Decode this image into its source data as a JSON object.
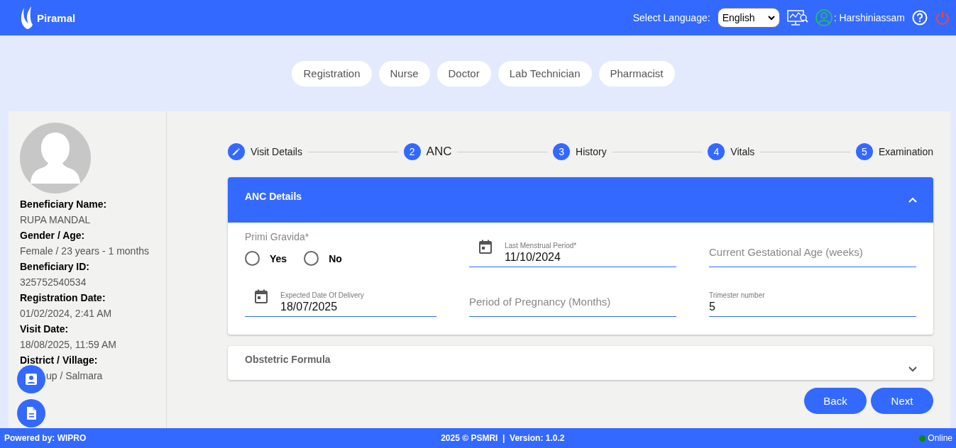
{
  "header": {
    "brand": "Piramal",
    "language_label": "Select Language:",
    "language": "English",
    "user": ": Harshiniassam"
  },
  "roles": [
    {
      "label": "Registration"
    },
    {
      "label": "Nurse"
    },
    {
      "label": "Doctor"
    },
    {
      "label": "Lab Technician"
    },
    {
      "label": "Pharmacist"
    }
  ],
  "beneficiary": [
    {
      "label": "Beneficiary Name:",
      "value": "RUPA MANDAL"
    },
    {
      "label": "Gender / Age:",
      "value": "Female / 23 years - 1 months"
    },
    {
      "label": "Beneficiary ID:",
      "value": "325752540534"
    },
    {
      "label": "Registration Date:",
      "value": "01/02/2024, 2:41 AM"
    },
    {
      "label": "Visit Date:",
      "value": "18/08/2025, 11:59 AM"
    },
    {
      "label": "District / Village:",
      "value": "up / Salmara"
    }
  ],
  "steps": [
    {
      "label": "Visit Details",
      "completed": true,
      "active": false
    },
    {
      "number": "2",
      "label": "ANC",
      "completed": false,
      "active": true
    },
    {
      "number": "3",
      "label": "History",
      "completed": false,
      "active": false
    },
    {
      "number": "4",
      "label": "Vitals",
      "completed": false,
      "active": false
    },
    {
      "number": "5",
      "label": "Examination",
      "completed": false,
      "active": false
    }
  ],
  "anc_panel": {
    "title": "ANC Details",
    "expanded": true,
    "primi_gravida": {
      "label": "Primi Gravida*",
      "options": [
        {
          "label": "Yes",
          "selected": false
        },
        {
          "label": "No",
          "selected": false
        }
      ]
    },
    "fields": [
      {
        "kind": "date",
        "label": "Last Menstrual Period*",
        "value": "11/10/2024"
      },
      {
        "kind": "text",
        "placeholder": "Current Gestational Age (weeks)"
      },
      {
        "kind": "date",
        "label": "Expected Date Of Delivery",
        "value": "18/07/2025"
      },
      {
        "kind": "text",
        "placeholder": "Period of Pregnancy (Months)"
      },
      {
        "kind": "text",
        "label": "Trimester number",
        "value": "5"
      }
    ]
  },
  "obstetric_panel": {
    "title": "Obstetric Formula",
    "expanded": false
  },
  "buttons": [
    "Back",
    "Next"
  ],
  "footer": {
    "powered": "Powered by: WIPRO",
    "copyright": "2025 © PSMRI  |  Version: 1.0.2",
    "status": "Online"
  }
}
